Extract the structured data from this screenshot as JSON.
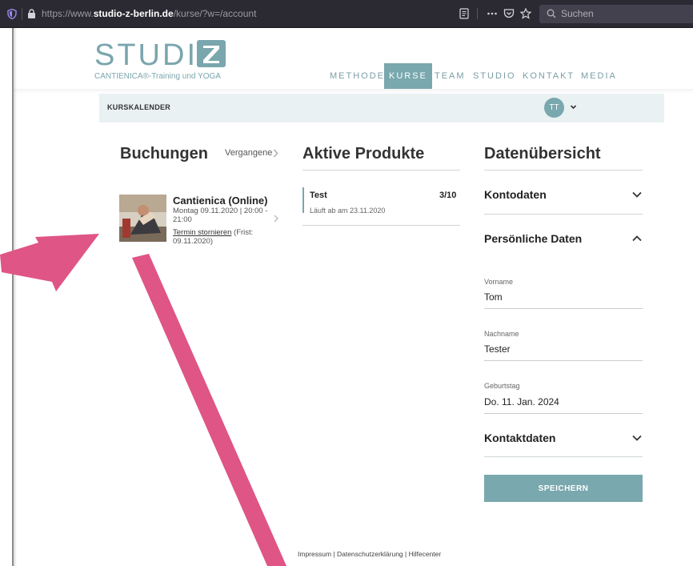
{
  "browser": {
    "url_prefix": "https://www.",
    "url_domain": "studio-z-berlin.de",
    "url_path": "/kurse/?w=/account",
    "search_placeholder": "Suchen"
  },
  "brand": {
    "logo_word": "STUDIO",
    "tagline": "CANTIENICA®-Training und YOGA",
    "accent_color": "#79a8ae"
  },
  "nav": {
    "items": [
      "METHODE",
      "KURSE",
      "TEAM",
      "STUDIO",
      "KONTAKT",
      "MEDIA"
    ],
    "active": "KURSE"
  },
  "subbar": {
    "label": "KURSKALENDER",
    "avatar_initials": "TT"
  },
  "bookings": {
    "title": "Buchungen",
    "past_link": "Vergangene",
    "item": {
      "title": "Cantienica (Online)",
      "time": "Montag 09.11.2020 | 20:00 - 21:00",
      "cancel_link": "Termin stornieren",
      "deadline": " (Frist: 09.11.2020)"
    }
  },
  "products": {
    "title": "Aktive Produkte",
    "item": {
      "name": "Test",
      "count": "3/10",
      "expires": "Läuft ab am 23.11.2020"
    }
  },
  "overview": {
    "title": "Datenübersicht",
    "account_section": "Kontodaten",
    "personal_section": "Persönliche Daten",
    "contact_section": "Kontaktdaten",
    "fields": {
      "firstname_label": "Vorname",
      "firstname_value": "Tom",
      "lastname_label": "Nachname",
      "lastname_value": "Tester",
      "birthday_label": "Geburtstag",
      "birthday_value": "Do. 11. Jan. 2024"
    },
    "save_label": "SPEICHERN"
  },
  "footer": {
    "text": "Impressum | Datenschutzerklärung | Hilfecenter"
  }
}
